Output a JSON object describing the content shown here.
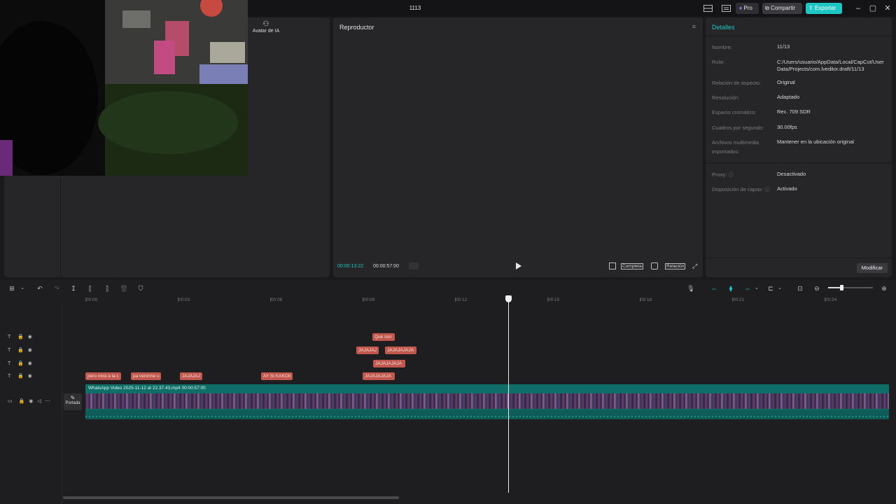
{
  "window": {
    "title": "1113",
    "pro_label": "Pro",
    "share_label": "Compartir",
    "export_label": "Exportar",
    "accent": "#1fc7c2"
  },
  "media": {
    "ai_avatar_label": "Avatar de IA"
  },
  "player": {
    "title": "Reproductor",
    "current_time": "00:00:13:22",
    "total_time": "00:00:57:00",
    "full_label": "Completa",
    "ratio_label": "Relación"
  },
  "details": {
    "title": "Detalles",
    "rows": [
      {
        "label": "Nombre:",
        "value": "11/13"
      },
      {
        "label": "Ruta:",
        "value": "C:/Users/usuario/AppData/Local/CapCut/User Data/Projects/com.lveditor.draft/11/13"
      },
      {
        "label": "Relación de aspecto:",
        "value": "Original"
      },
      {
        "label": "Resolución:",
        "value": "Adaptado"
      },
      {
        "label": "Espacio cromático:",
        "value": "Rec. 709 SDR"
      },
      {
        "label": "Cuadros por segundo:",
        "value": "30.00fps"
      },
      {
        "label": "Archivos multimedia importados:",
        "value": "Mantener en la ubicación original"
      },
      {
        "label": "Proxy:",
        "value": "Desactivado"
      },
      {
        "label": "Disposición de capas:",
        "value": "Activado"
      }
    ],
    "modify_label": "Modificar"
  },
  "timeline": {
    "ticks": [
      "00:00",
      "00:03",
      "00:06",
      "00:09",
      "00:12",
      "00:15",
      "00:18",
      "00:21",
      "00:24"
    ],
    "text_clips": [
      {
        "text": "Que son",
        "track": 0
      },
      {
        "text": "JAJAJAJ",
        "track": 1
      },
      {
        "text": "JAJAJAJAJA",
        "track": 1
      },
      {
        "text": "JAJAJAJAJA",
        "track": 2
      },
      {
        "text": "pero mira a la c",
        "track": 3
      },
      {
        "text": "pa venirme u",
        "track": 3
      },
      {
        "text": "JAJAJAJ",
        "track": 3
      },
      {
        "text": "AY SI KAKOII",
        "track": 3
      },
      {
        "text": "JAJAJAJAJA",
        "track": 3
      }
    ],
    "video_clip_label": "WhatsApp Video 2025-11-12 at 22.37.43.mp4   00:00:57:00",
    "cover_label": "Portada"
  }
}
